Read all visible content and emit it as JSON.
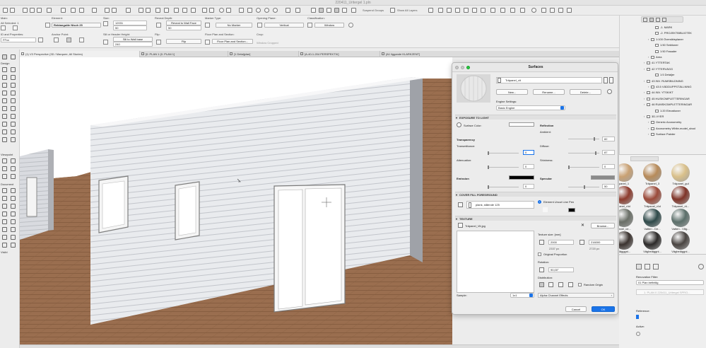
{
  "window": {
    "title": "220411_Uritergel 1.pln"
  },
  "toolbar": {
    "suspend_groups": "Suspend Groups",
    "show_all_layers": "Show All Layers"
  },
  "infobox": {
    "main_label": "Main:",
    "all_selected_label": "All Selected: 1",
    "element_label": "Element:",
    "element_value": "Rektangulär Nisch 25",
    "size_label": "Size:",
    "size_w": "12031",
    "size_h": "50",
    "reveal_label": "Reveal Depth:",
    "reveal_value": "Reveal to Wall Face",
    "reveal_num": "50",
    "marker_label": "Marker Type:",
    "marker_value": "No Marker",
    "opening_plane_label": "Opening Plane:",
    "opening_plane_value": "Vertical",
    "classification_label": "Classification:",
    "classification_value": "Window",
    "id_label": "ID and Properties:",
    "id_value": "FFxx",
    "anchor_label": "Anchor Point:",
    "sill_label": "Sill or Header Height:",
    "sill_value": "Sill to Wall base",
    "sill_num": "240",
    "flip_label": "Flip:",
    "flip_value": "Flip",
    "floor_plan_label": "Floor Plan and Section:",
    "floor_plan_value": "Floor Plan and Section...",
    "crop_label": "Crop:",
    "crop_value": "Window Cropped"
  },
  "tabs": [
    {
      "label": "(1) V3 Perspective (3D / Marquee, All Stories)"
    },
    {
      "label": "[0. PLAN 1 (0. PLAN 1]"
    },
    {
      "label": "[1 Detaljplan]"
    },
    {
      "label": "[A-40-1-204 PERSPEKTIV]"
    },
    {
      "label": "[A1 liggande KLARKZENT]"
    }
  ],
  "toolbox": {
    "design_header": "Design",
    "viewpoint_header": "Viewpoint",
    "document_header": "Document",
    "visible_header": "Visibl"
  },
  "dialog": {
    "title": "Surfaces",
    "surface_name": "Träpanel_vit",
    "new_button": "New...",
    "rename_button": "Rename...",
    "delete_button": "Delete...",
    "engine_settings_label": "Engine Settings:",
    "engine_value": "Basic Engine",
    "exposure_section": "EXPOSURE TO LIGHT",
    "surface_color_label": "Surface Color:",
    "reflection_label": "Reflection",
    "ambient_label": "Ambient:",
    "ambient_value": "82",
    "transparency_label": "Transparency",
    "transmittance_label": "Transmittance:",
    "transmittance_value": "0",
    "diffuse_label": "Diffuse:",
    "diffuse_value": "87",
    "attenuation_label": "Attenuation:",
    "attenuation_value": "0",
    "shininess_label": "Shininess:",
    "shininess_value": "0",
    "emission_label": "Emission",
    "emission_value": "0",
    "specular_label": "Specular",
    "specular_value": "50",
    "cover_fill_section": "COVER FILL FOREGROUND",
    "element_uncut_pen": "Element Uncut Line Pen",
    "fill_value": "plank, stående 125",
    "texture_section": "TEXTURE",
    "texture_name": "Träpanel_Vit.jpg",
    "browse_button": "Browse...",
    "texture_size_label": "Texture size: [mm]",
    "tex_w": "2000",
    "tex_h": "216000",
    "tex_w_px": "2337 px",
    "tex_h_px": "2720 px",
    "original_proportion": "Original Proportion",
    "rotation_label": "Rotation:",
    "rotation_value": "90,00°",
    "distribution_label": "Distribution:",
    "random_origin": "Random Origin",
    "alpha_channel": "Alpha Channel Effects",
    "sample_label": "Sample:",
    "sample_value": "1x1",
    "cancel_button": "Cancel",
    "ok_button": "OK"
  },
  "navigator": {
    "items": [
      {
        "label": "-1. MARK",
        "indent": 3
      },
      {
        "label": "-2. PROJEKTBIBLIOTEK",
        "indent": 3
      },
      {
        "label": "1:100 Översiktsplaner",
        "indent": 2
      },
      {
        "label": "1:50 Sektioner",
        "indent": 3
      },
      {
        "label": "1:50 Fasader",
        "indent": 3
      },
      {
        "label": "Area",
        "indent": 2
      },
      {
        "label": "41 YTTERTAK",
        "indent": 1
      },
      {
        "label": "42 YTTERVÄGG",
        "indent": 1
      },
      {
        "label": "1:5 Detaljer",
        "indent": 3
      },
      {
        "label": "43 INV. RUMSBILDNING",
        "indent": 1
      },
      {
        "label": "43.5 VÄDDUPPSTÄLLNING",
        "indent": 2
      },
      {
        "label": "44 INV. YTSKIKT",
        "indent": 1
      },
      {
        "label": "45 HUSKOMPLETTERINGAR",
        "indent": 1
      },
      {
        "label": "46 RUMSKOMPLETTERINGAR",
        "indent": 1
      },
      {
        "label": "1:20 Elevationer",
        "indent": 3
      },
      {
        "label": "3D-VYER",
        "indent": 1
      },
      {
        "label": "Generic Axonometry",
        "indent": 2
      },
      {
        "label": "Axonometry White-model_shad",
        "indent": 2
      },
      {
        "label": "Surface Painter",
        "indent": 2
      }
    ]
  },
  "materials": [
    {
      "label": "panel_1",
      "color": "#c9a173"
    },
    {
      "label": "Träpanel_3",
      "color": "#b78b5a"
    },
    {
      "label": "Träpanel_gul",
      "color": "#d9c08a"
    },
    {
      "label": "panel_röd",
      "color": "#8d3b2d"
    },
    {
      "label": "Träpanel_röd",
      "color": "#9b4a3a"
    },
    {
      "label": "Träpanel_rö...",
      "color": "#7f3428"
    },
    {
      "label": "panel_ce...",
      "color": "#6a6f67"
    },
    {
      "label": "Vatten - De...",
      "color": "#2f4a4a"
    },
    {
      "label": "Vatten - Våg...",
      "color": "#5b6f6a"
    },
    {
      "label": "elägggni...",
      "color": "#3b332f"
    },
    {
      "label": "Vägbeläggni...",
      "color": "#2c2a29"
    },
    {
      "label": "Vägbeläggni...",
      "color": "#4a4542"
    }
  ],
  "rbottom": {
    "renovation_filter_label": "Renovation Filter:",
    "renovation_filter_value": "01 Plan befintlig",
    "reference_label": "Reference:",
    "active_label": "Active:",
    "layout_item": "1. PLAN 0 220411_Uritergel SPRO..."
  },
  "colors": {
    "wall_face": "#ebedf0",
    "floor": "#9a6e4f",
    "ok_blue": "#1a73e8"
  }
}
